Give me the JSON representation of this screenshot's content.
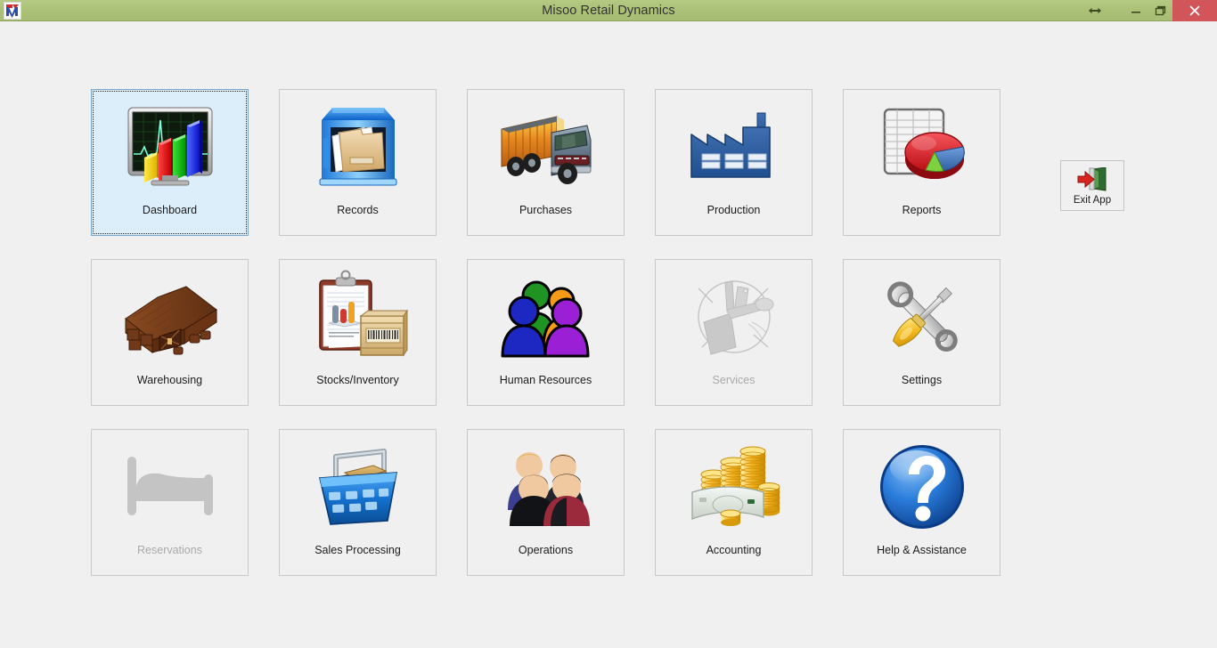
{
  "window": {
    "title": "Misoo Retail Dynamics",
    "app_icon": "app-logo-icon",
    "controls": {
      "resize": "↔",
      "minimize": "—",
      "maximize": "❐",
      "close": "✕"
    },
    "colors": {
      "titlebar": "#abc177",
      "close_button": "#d2555a",
      "client_background": "#f0f0f0",
      "tile_border": "#c8c8c8",
      "selected_tile_background": "#ddeefb",
      "selected_tile_border": "#7aa7cc",
      "disabled_label": "#a9a9a9"
    }
  },
  "menu": {
    "rows": [
      [
        {
          "label": "Dashboard",
          "icon": "dashboard-monitor-chart-icon",
          "state": "selected"
        },
        {
          "label": "Records",
          "icon": "file-cabinet-folders-icon",
          "state": "enabled"
        },
        {
          "label": "Purchases",
          "icon": "delivery-truck-icon",
          "state": "enabled"
        },
        {
          "label": "Production",
          "icon": "factory-icon",
          "state": "enabled"
        },
        {
          "label": "Reports",
          "icon": "spreadsheet-pie-chart-icon",
          "state": "enabled"
        }
      ],
      [
        {
          "label": "Warehousing",
          "icon": "warehouse-barn-icon",
          "state": "enabled"
        },
        {
          "label": "Stocks/Inventory",
          "icon": "clipboard-crate-icon",
          "state": "enabled"
        },
        {
          "label": "Human Resources",
          "icon": "people-group-icon",
          "state": "enabled"
        },
        {
          "label": "Services",
          "icon": "utensils-tools-icon",
          "state": "disabled"
        },
        {
          "label": "Settings",
          "icon": "wrench-screwdriver-icon",
          "state": "enabled"
        }
      ],
      [
        {
          "label": "Reservations",
          "icon": "bed-icon",
          "state": "disabled"
        },
        {
          "label": "Sales Processing",
          "icon": "shopping-basket-boxes-icon",
          "state": "enabled"
        },
        {
          "label": "Operations",
          "icon": "avatars-team-icon",
          "state": "enabled"
        },
        {
          "label": "Accounting",
          "icon": "coins-banknote-icon",
          "state": "enabled"
        },
        {
          "label": "Help & Assistance",
          "icon": "question-mark-sphere-icon",
          "state": "enabled"
        }
      ]
    ]
  },
  "exit": {
    "label": "Exit App",
    "icon": "exit-door-arrow-icon"
  }
}
